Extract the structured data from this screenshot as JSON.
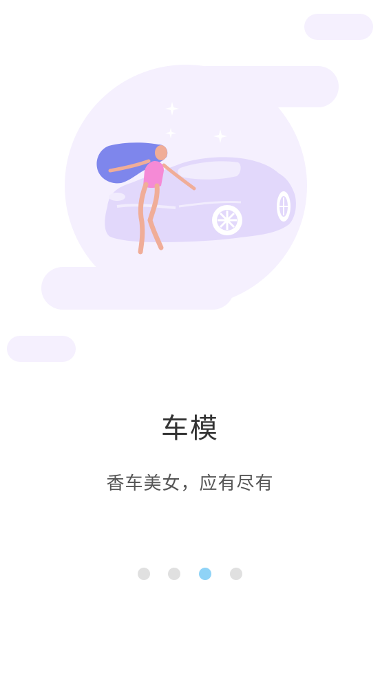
{
  "onboarding": {
    "title": "车模",
    "subtitle": "香车美女，应有尽有",
    "current_page": 3,
    "total_pages": 4
  },
  "illustration": {
    "subject": "woman-with-car-illustration"
  },
  "colors": {
    "cloud": "#f5f0fe",
    "car": "#e2d8fb",
    "hair": "#7e86ec",
    "swimsuit": "#f58ad6",
    "skin": "#f0ad98",
    "active_dot": "#8fd3f7",
    "inactive_dot": "#e0e0e0"
  }
}
